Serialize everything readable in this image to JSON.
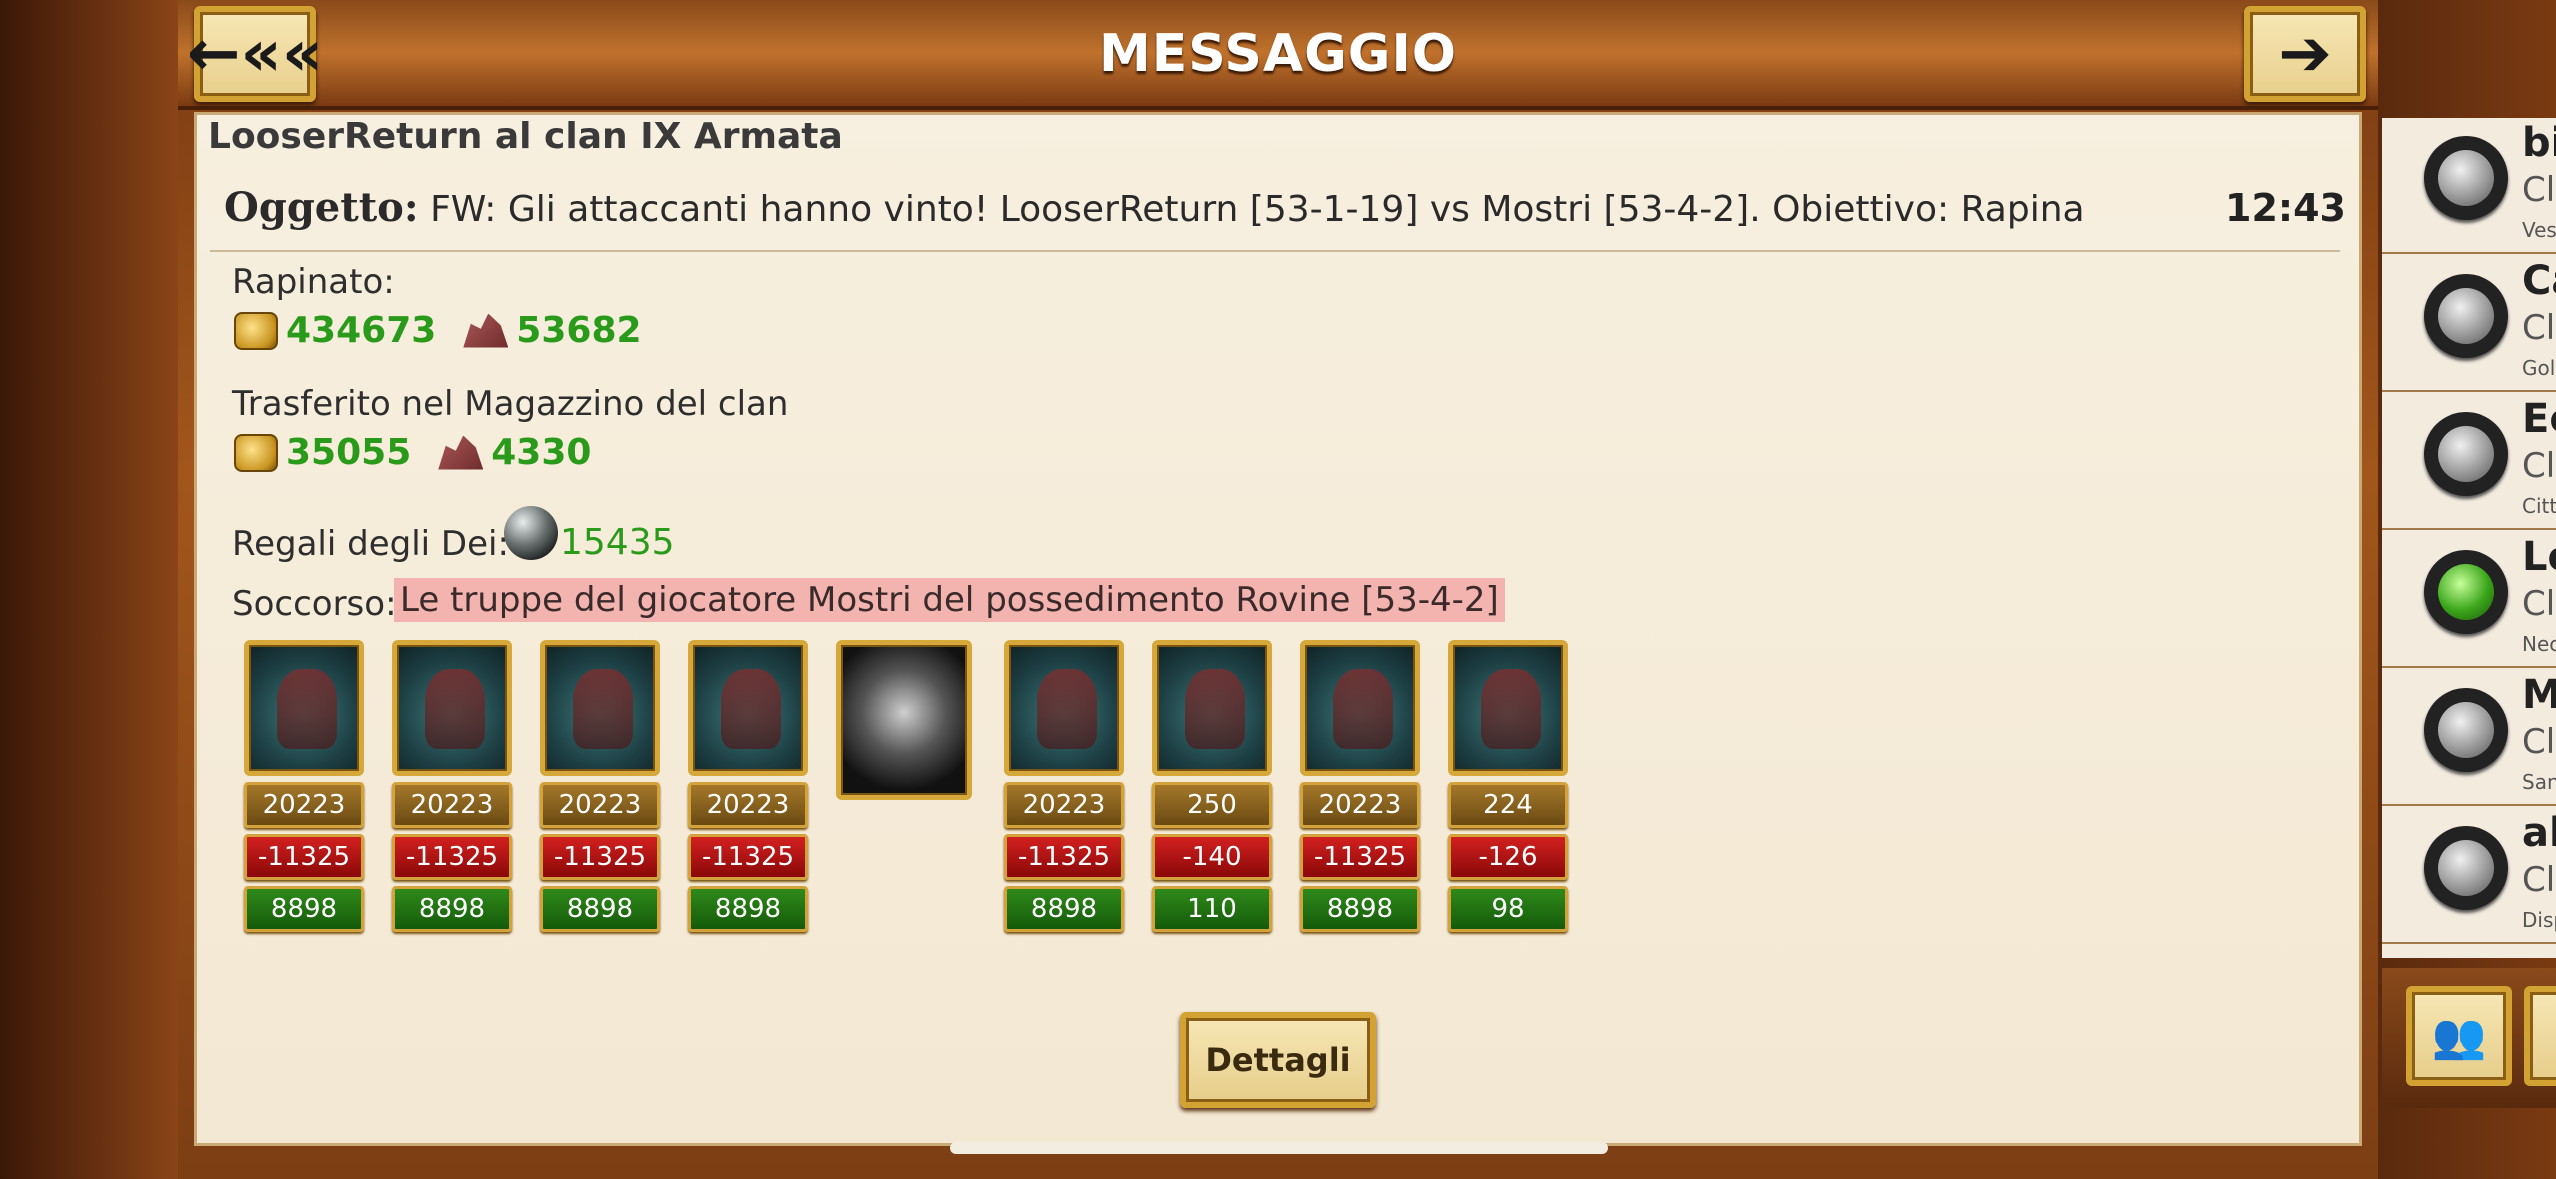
{
  "header": {
    "title": "MESSAGGIO",
    "back_icon": "back-arrow-icon",
    "forward_icon": "forward-arrow-icon",
    "back_label": "←««",
    "forward_label": "➔"
  },
  "message": {
    "from": "LooserReturn al clan IX Armata",
    "subject_label": "Oggetto:",
    "subject": "FW: Gli attaccanti hanno vinto! LooserReturn [53-1-19] vs Mostri [53-4-2]. Obiettivo: Rapina",
    "time": "12:43"
  },
  "plundered": {
    "label": "Rapinato:",
    "gold": "434673",
    "ore": "53682"
  },
  "transferred": {
    "label": "Trasferito nel Magazzino del clan",
    "gold": "35055",
    "ore": "4330"
  },
  "gifts": {
    "label": "Regali degli Dei:",
    "value": "15435"
  },
  "reinforcement": {
    "label": "Soccorso:",
    "text": "Le truppe del giocatore Mostri del possedimento Rovine [53-4-2]"
  },
  "units": [
    {
      "total": "20223",
      "loss": "-11325",
      "remaining": "8898"
    },
    {
      "total": "20223",
      "loss": "-11325",
      "remaining": "8898"
    },
    {
      "total": "20223",
      "loss": "-11325",
      "remaining": "8898"
    },
    {
      "total": "20223",
      "loss": "-11325",
      "remaining": "8898"
    },
    {
      "total": "20223",
      "loss": "-11325",
      "remaining": "8898"
    },
    {
      "total": "250",
      "loss": "-140",
      "remaining": "110"
    },
    {
      "total": "20223",
      "loss": "-11325",
      "remaining": "8898"
    },
    {
      "total": "224",
      "loss": "-126",
      "remaining": "98"
    }
  ],
  "details_button": "Dettagli",
  "sidebar": {
    "items": [
      {
        "name": "bia",
        "sub": "Cla",
        "sub2": "Ves",
        "status": "gray"
      },
      {
        "name": "Ca",
        "sub": "Cla",
        "sub2": "Gol",
        "status": "gray"
      },
      {
        "name": "Ec",
        "sub": "Cla",
        "sub2": "Citt",
        "status": "gray"
      },
      {
        "name": "Lo",
        "sub": "Cla",
        "sub2": "Nec",
        "status": "green"
      },
      {
        "name": "Ma",
        "sub": "Cla",
        "sub2": "San",
        "status": "gray"
      },
      {
        "name": "al",
        "sub": "Cla",
        "sub2": "Disp",
        "status": "gray"
      }
    ]
  },
  "colors": {
    "accent_gold": "#d2a233",
    "positive_green": "#2a9a1a",
    "loss_red": "#d32020",
    "highlight_pink": "#f3b4b0"
  }
}
